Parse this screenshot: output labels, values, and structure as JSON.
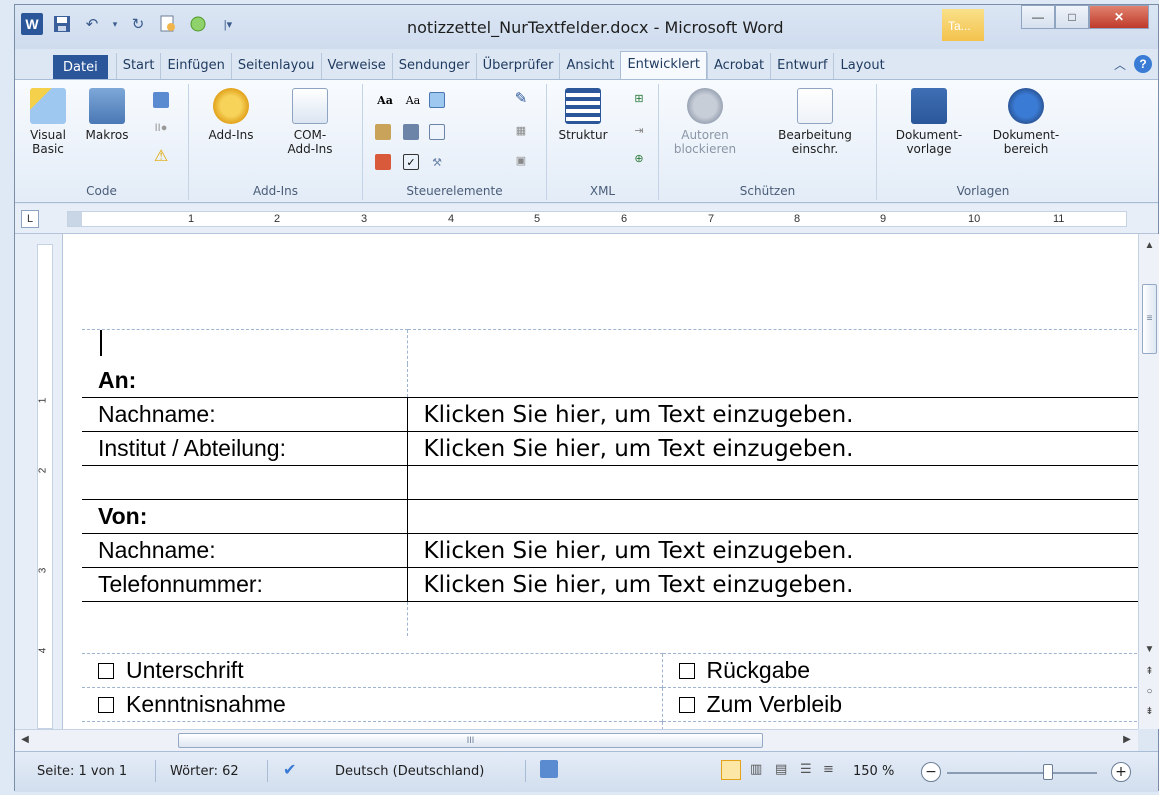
{
  "window": {
    "title": "notizzettel_NurTextfelder.docx - Microsoft Word",
    "context_tab": "Ta...",
    "minimize": "—",
    "maximize": "□",
    "close": "✕"
  },
  "tabs": [
    "Datei",
    "Start",
    "Einfügen",
    "Seitenlayou",
    "Verweise",
    "Sendunger",
    "Überprüfer",
    "Ansicht",
    "Entwicklert",
    "Acrobat",
    "Entwurf",
    "Layout"
  ],
  "active_tab": "Entwicklert",
  "ribbon": {
    "code": {
      "label": "Code",
      "visual_basic": "Visual Basic",
      "macros": "Makros"
    },
    "addins": {
      "label": "Add-Ins",
      "addins": "Add-Ins",
      "com_addins": "COM-Add-Ins"
    },
    "controls": {
      "label": "Steuerelemente"
    },
    "xml": {
      "label": "XML",
      "structure": "Struktur"
    },
    "protect": {
      "label": "Schützen",
      "block_authors": "Autoren blockieren",
      "restrict_editing": "Bearbeitung einschr."
    },
    "templates": {
      "label": "Vorlagen",
      "doc_template": "Dokument-vorlage",
      "doc_panel": "Dokument-bereich"
    }
  },
  "ruler": {
    "numbers": [
      "1",
      "2",
      "3",
      "4",
      "5",
      "6",
      "7",
      "8",
      "9",
      "10",
      "11"
    ],
    "vertical_numbers": [
      "1",
      "2",
      "3",
      "4"
    ]
  },
  "document": {
    "to_heading": "An:",
    "to_lastname_label": "Nachname:",
    "to_lastname_placeholder": "Klicken Sie hier, um Text einzugeben.",
    "to_institute_label": "Institut / Abteilung:",
    "to_institute_placeholder": "Klicken Sie hier, um Text einzugeben.",
    "from_heading": "Von:",
    "from_lastname_label": "Nachname:",
    "from_lastname_placeholder": "Klicken Sie hier, um Text einzugeben.",
    "from_phone_label": "Telefonnummer:",
    "from_phone_placeholder": "Klicken Sie hier, um Text einzugeben.",
    "checkboxes": {
      "signature": "Unterschrift",
      "return": "Rückgabe",
      "acknowledgement": "Kenntnisnahme",
      "keep": "Zum Verbleib"
    }
  },
  "statusbar": {
    "page": "Seite: 1 von 1",
    "words": "Wörter: 62",
    "language": "Deutsch (Deutschland)",
    "zoom": "150 %"
  }
}
